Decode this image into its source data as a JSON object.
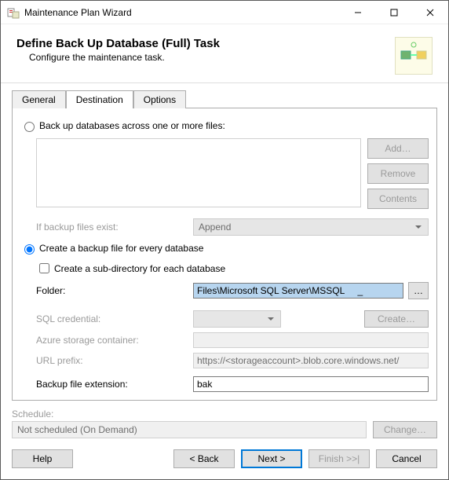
{
  "window": {
    "title": "Maintenance Plan Wizard"
  },
  "header": {
    "title": "Define Back Up Database (Full) Task",
    "subtitle": "Configure the maintenance task."
  },
  "tabs": {
    "general": "General",
    "destination": "Destination",
    "options": "Options",
    "active": "destination"
  },
  "dest": {
    "radio_across_files": "Back up databases across one or more files:",
    "btn_add": "Add…",
    "btn_remove": "Remove",
    "btn_contents": "Contents",
    "if_exist_label": "If backup files exist:",
    "if_exist_value": "Append",
    "radio_per_db": "Create a backup file for every database",
    "chk_subdir": "Create a sub-directory for each database",
    "folder_label": "Folder:",
    "folder_value": "Files\\Microsoft SQL Server\\MSSQL     _",
    "sql_cred_label": "SQL credential:",
    "sql_cred_value": "",
    "btn_create": "Create…",
    "azure_label": "Azure storage container:",
    "azure_value": "",
    "url_label": "URL prefix:",
    "url_value": "https://<storageaccount>.blob.core.windows.net/",
    "ext_label": "Backup file extension:",
    "ext_value": "bak"
  },
  "schedule": {
    "label": "Schedule:",
    "value": "Not scheduled (On Demand)",
    "btn_change": "Change…"
  },
  "footer": {
    "help": "Help",
    "back": "< Back",
    "next": "Next >",
    "finish": "Finish >>|",
    "cancel": "Cancel"
  }
}
